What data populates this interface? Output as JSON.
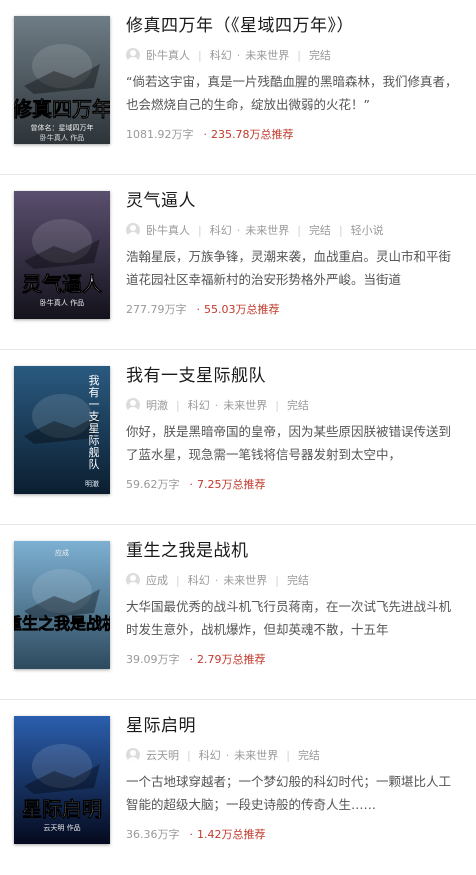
{
  "books": [
    {
      "title": "修真四万年（《星域四万年》）",
      "author": "卧牛真人",
      "category": "科幻",
      "subcategory": "未来世界",
      "status": "完结",
      "tag": "",
      "desc": "“倘若这宇宙，真是一片残酷血腥的黑暗森林，我们修真者，也会燃烧自己的生命，绽放出微弱的火花！”",
      "words": "1081.92万字",
      "recommend": "235.78万总推荐",
      "cover": {
        "main": "修真四万年",
        "sub": "曾体名：星域四万年",
        "author": "卧牛真人 作品",
        "colors": [
          "#6f7d86",
          "#2d3439"
        ]
      }
    },
    {
      "title": "灵气逼人",
      "author": "卧牛真人",
      "category": "科幻",
      "subcategory": "未来世界",
      "status": "完结",
      "tag": "轻小说",
      "desc": "浩翰星辰，万族争锋，灵潮来袭，血战重启。灵山市和平街道花园社区幸福新村的治安形势格外严峻。当街道",
      "words": "277.79万字",
      "recommend": "55.03万总推荐",
      "cover": {
        "main": "灵气逼人",
        "sub": "卧牛真人 作品",
        "author": "",
        "colors": [
          "#5a4f6f",
          "#14121c"
        ]
      }
    },
    {
      "title": "我有一支星际舰队",
      "author": "明澈",
      "category": "科幻",
      "subcategory": "未来世界",
      "status": "完结",
      "tag": "",
      "desc": "你好，朕是黑暗帝国的皇帝，因为某些原因朕被错误传送到了蓝水星，现急需一笔钱将信号器发射到太空中，",
      "words": "59.62万字",
      "recommend": "7.25万总推荐",
      "cover": {
        "main": "我有一支星际舰队",
        "sub": "",
        "author": "明澈",
        "colors": [
          "#2a5a80",
          "#0b1e30"
        ]
      }
    },
    {
      "title": "重生之我是战机",
      "author": "应成",
      "category": "科幻",
      "subcategory": "未来世界",
      "status": "完结",
      "tag": "",
      "desc": "大华国最优秀的战斗机飞行员蒋南，在一次试飞先进战斗机时发生意外，战机爆炸，但却英魂不散，十五年",
      "words": "39.09万字",
      "recommend": "2.79万总推荐",
      "cover": {
        "main": "重生之我是战机",
        "sub": "应成",
        "author": "",
        "colors": [
          "#7db0d2",
          "#2e4a5e"
        ]
      }
    },
    {
      "title": "星际启明",
      "author": "云天明",
      "category": "科幻",
      "subcategory": "未来世界",
      "status": "完结",
      "tag": "",
      "desc": "一个古地球穿越者；一个梦幻般的科幻时代；一颗堪比人工智能的超级大脑；一段史诗般的传奇人生……",
      "words": "36.36万字",
      "recommend": "1.42万总推荐",
      "cover": {
        "main": "星际启明",
        "sub": "云天明 作品",
        "author": "",
        "colors": [
          "#2b5fae",
          "#050a1e"
        ]
      }
    }
  ]
}
